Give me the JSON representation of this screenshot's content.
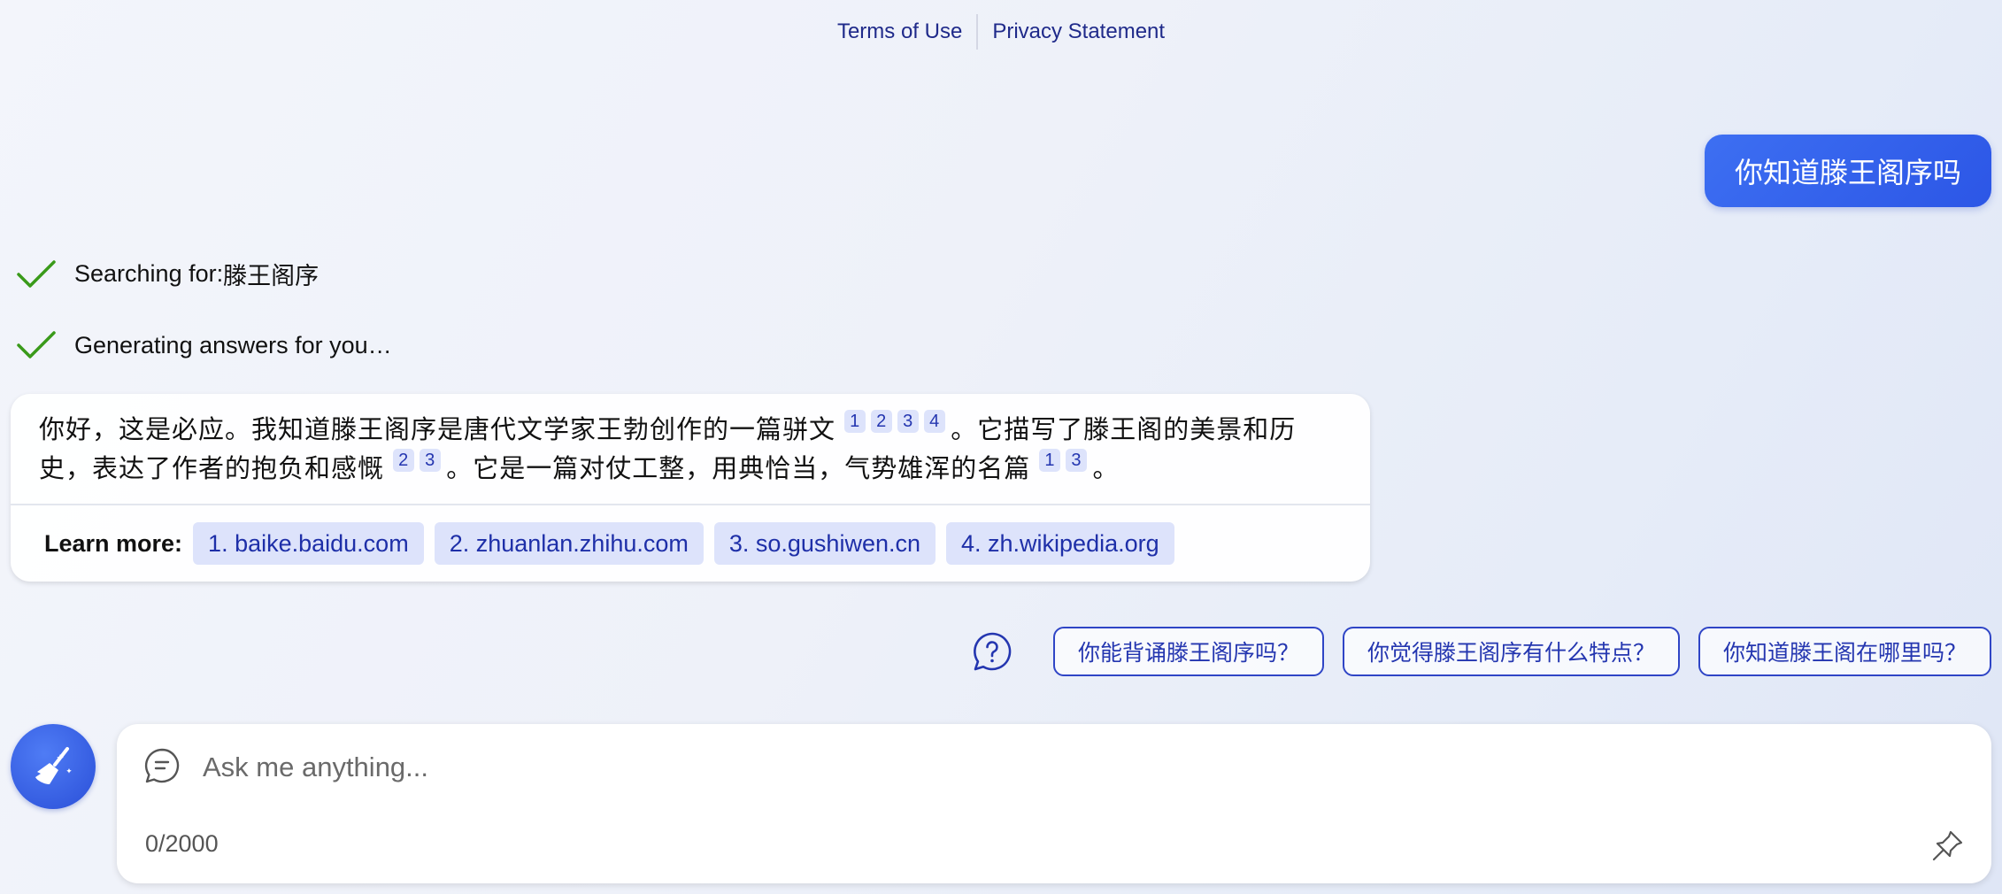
{
  "footer": {
    "terms": "Terms of Use",
    "privacy": "Privacy Statement"
  },
  "user_message": "你知道滕王阁序吗",
  "status": {
    "searching_prefix": "Searching for: ",
    "searching_query": "滕王阁序",
    "generating": "Generating answers for you…"
  },
  "answer": {
    "seg1": "你好，这是必应。我知道滕王阁序是唐代文学家王勃创作的一篇骈文",
    "seg2": "。它描写了滕王阁的美景和历史，表达了作者的抱负和感慨",
    "seg3": "。它是一篇对仗工整，用典恰当，气势雄浑的名篇",
    "seg4": "。",
    "cites1": [
      "1",
      "2",
      "3",
      "4"
    ],
    "cites2": [
      "2",
      "3"
    ],
    "cites3": [
      "1",
      "3"
    ]
  },
  "learn_more": {
    "label": "Learn more:",
    "sources": [
      "1. baike.baidu.com",
      "2. zhuanlan.zhihu.com",
      "3. so.gushiwen.cn",
      "4. zh.wikipedia.org"
    ]
  },
  "suggestions": [
    "你能背诵滕王阁序吗？",
    "你觉得滕王阁序有什么特点？",
    "你知道滕王阁在哪里吗？"
  ],
  "composer": {
    "placeholder": "Ask me anything...",
    "counter": "0/2000"
  },
  "colors": {
    "accent": "#2c56e6",
    "chip_bg": "#dde3fb",
    "link": "#1f2a8a",
    "check": "#3a9a1a"
  },
  "icons": {
    "check": "check-icon",
    "help": "question-circle-icon",
    "broom": "broom-icon",
    "chat": "chat-bubble-icon",
    "pin": "pin-icon"
  }
}
